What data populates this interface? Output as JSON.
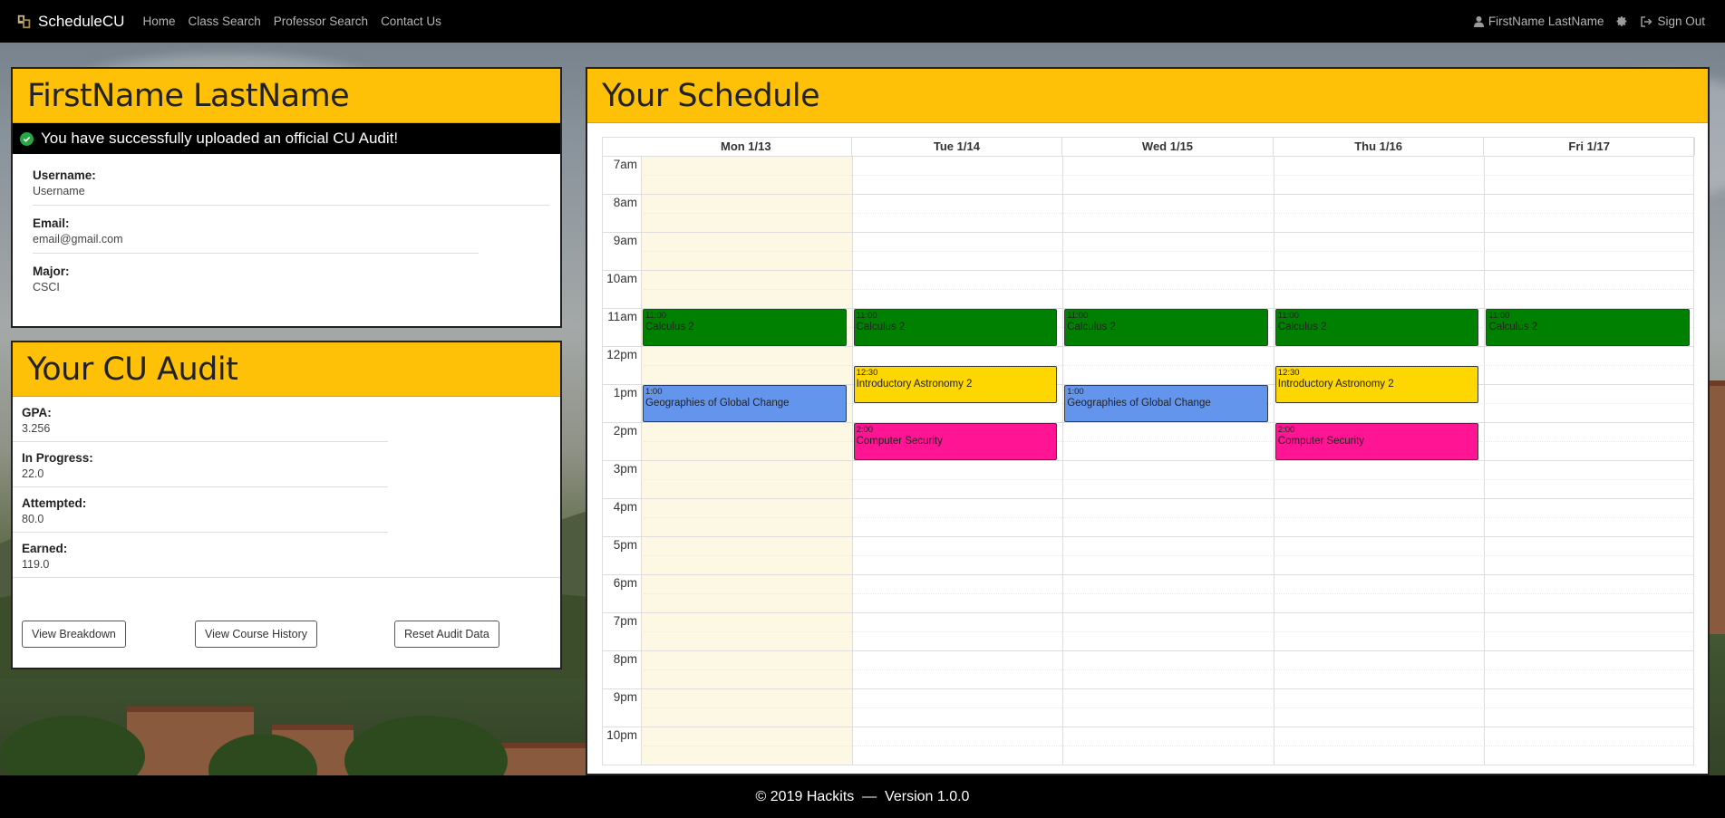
{
  "navbar": {
    "brand": "ScheduleCU",
    "links": [
      "Home",
      "Class Search",
      "Professor Search",
      "Contact Us"
    ],
    "user_name": "FirstName LastName",
    "sign_out": "Sign Out"
  },
  "profile": {
    "name": "FirstName LastName",
    "alert": "You have successfully uploaded an official CU Audit!",
    "fields": [
      {
        "label": "Username:",
        "value": "Username"
      },
      {
        "label": "Email:",
        "value": "email@gmail.com"
      },
      {
        "label": "Major:",
        "value": "CSCI"
      }
    ]
  },
  "audit": {
    "title": "Your CU Audit",
    "fields": [
      {
        "label": "GPA:",
        "value": "3.256"
      },
      {
        "label": "In Progress:",
        "value": "22.0"
      },
      {
        "label": "Attempted:",
        "value": "80.0"
      },
      {
        "label": "Earned:",
        "value": "119.0"
      }
    ],
    "buttons": [
      "View Breakdown",
      "View Course History",
      "Reset Audit Data"
    ]
  },
  "schedule": {
    "title": "Your Schedule",
    "days": [
      "Mon 1/13",
      "Tue 1/14",
      "Wed 1/15",
      "Thu 1/16",
      "Fri 1/17"
    ],
    "hours": [
      "7am",
      "8am",
      "9am",
      "10am",
      "11am",
      "12pm",
      "1pm",
      "2pm",
      "3pm",
      "4pm",
      "5pm",
      "6pm",
      "7pm",
      "8pm",
      "9pm",
      "10pm"
    ],
    "today_index": 0,
    "events": [
      {
        "day": 0,
        "start": 11,
        "end": 12,
        "time": "11:00",
        "name": "Calculus 2",
        "color": "#008000"
      },
      {
        "day": 1,
        "start": 11,
        "end": 12,
        "time": "11:00",
        "name": "Calculus 2",
        "color": "#008000"
      },
      {
        "day": 2,
        "start": 11,
        "end": 12,
        "time": "11:00",
        "name": "Calculus 2",
        "color": "#008000"
      },
      {
        "day": 3,
        "start": 11,
        "end": 12,
        "time": "11:00",
        "name": "Calculus 2",
        "color": "#008000"
      },
      {
        "day": 4,
        "start": 11,
        "end": 12,
        "time": "11:00",
        "name": "Calculus 2",
        "color": "#008000"
      },
      {
        "day": 1,
        "start": 12.5,
        "end": 13.5,
        "time": "12:30",
        "name": "Introductory Astronomy 2",
        "color": "#ffd700"
      },
      {
        "day": 3,
        "start": 12.5,
        "end": 13.5,
        "time": "12:30",
        "name": "Introductory Astronomy 2",
        "color": "#ffd700"
      },
      {
        "day": 0,
        "start": 13,
        "end": 14,
        "time": "1:00",
        "name": "Geographies of Global Change",
        "color": "#6495ed"
      },
      {
        "day": 2,
        "start": 13,
        "end": 14,
        "time": "1:00",
        "name": "Geographies of Global Change",
        "color": "#6495ed"
      },
      {
        "day": 1,
        "start": 14,
        "end": 15,
        "time": "2:00",
        "name": "Computer Security",
        "color": "#ff1493"
      },
      {
        "day": 3,
        "start": 14,
        "end": 15,
        "time": "2:00",
        "name": "Computer Security",
        "color": "#ff1493"
      }
    ]
  },
  "footer": {
    "text": "© 2019 Hackits  —  Version 1.0.0"
  }
}
